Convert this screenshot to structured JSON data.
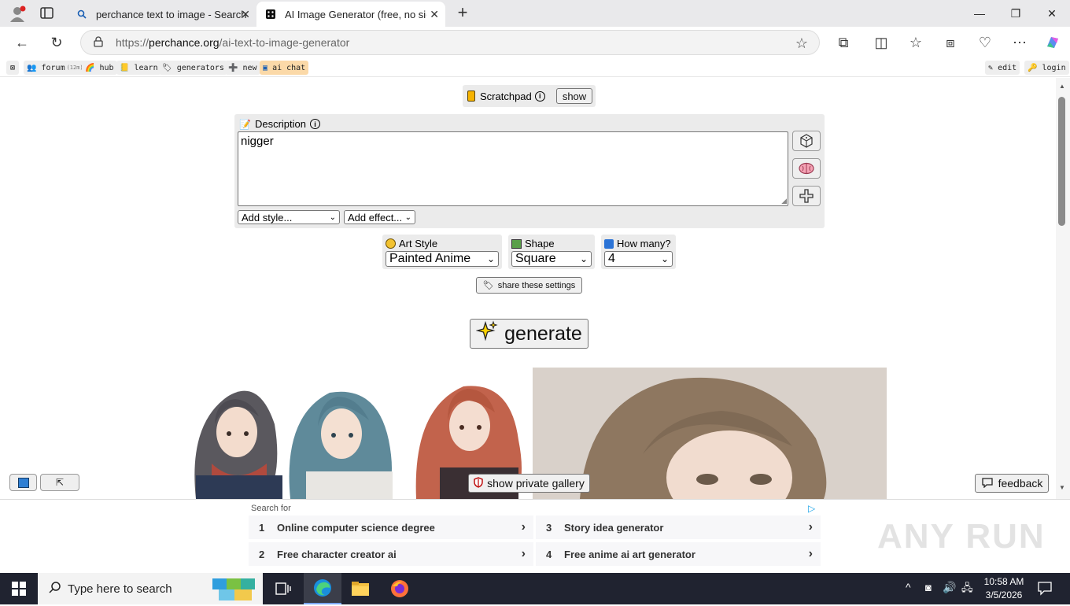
{
  "browser": {
    "tabs": [
      {
        "title": "perchance text to image - Search"
      },
      {
        "title": "AI Image Generator (free, no sign"
      }
    ],
    "url_prefix": "https://",
    "url_domain": "perchance.org",
    "url_path": "/ai-text-to-image-generator",
    "bookmarks": {
      "forum": "forum",
      "forum_count": "(12m)",
      "hub": "hub",
      "learn": "learn",
      "generators": "generators",
      "new": "new",
      "ai_chat": "ai chat",
      "edit": "edit",
      "login": "login"
    }
  },
  "page": {
    "scratchpad": {
      "label": "Scratchpad",
      "button": "show"
    },
    "description": {
      "label": "Description",
      "value": "nigger"
    },
    "add_style": "Add style...",
    "add_effect": "Add effect...",
    "art_style": {
      "label": "Art Style",
      "value": "Painted Anime"
    },
    "shape": {
      "label": "Shape",
      "value": "Square"
    },
    "how_many": {
      "label": "How many?",
      "value": "4"
    },
    "share_button": "share these settings",
    "generate_button": "generate",
    "private_gallery_button": "show private gallery",
    "feedback_button": "feedback"
  },
  "ad": {
    "search_for": "Search for",
    "items": [
      {
        "num": "1",
        "text": "Online computer science degree"
      },
      {
        "num": "3",
        "text": "Story idea generator"
      },
      {
        "num": "2",
        "text": "Free character creator ai"
      },
      {
        "num": "4",
        "text": "Free anime ai art generator"
      }
    ],
    "watermark": "ANY RUN"
  },
  "taskbar": {
    "search_placeholder": "Type here to search",
    "time": "10:58 AM",
    "date": "3/5/2026"
  },
  "colors": {
    "taskbar_bg": "#202330",
    "panel_gray": "#ebebeb",
    "ai_chat_bg": "#fbd9a8"
  }
}
